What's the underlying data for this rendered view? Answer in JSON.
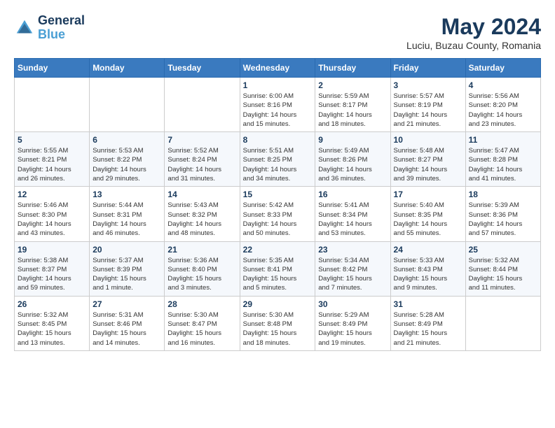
{
  "header": {
    "logo_line1": "General",
    "logo_line2": "Blue",
    "month_title": "May 2024",
    "location": "Luciu, Buzau County, Romania"
  },
  "weekdays": [
    "Sunday",
    "Monday",
    "Tuesday",
    "Wednesday",
    "Thursday",
    "Friday",
    "Saturday"
  ],
  "weeks": [
    [
      {
        "day": "",
        "info": ""
      },
      {
        "day": "",
        "info": ""
      },
      {
        "day": "",
        "info": ""
      },
      {
        "day": "1",
        "info": "Sunrise: 6:00 AM\nSunset: 8:16 PM\nDaylight: 14 hours\nand 15 minutes."
      },
      {
        "day": "2",
        "info": "Sunrise: 5:59 AM\nSunset: 8:17 PM\nDaylight: 14 hours\nand 18 minutes."
      },
      {
        "day": "3",
        "info": "Sunrise: 5:57 AM\nSunset: 8:19 PM\nDaylight: 14 hours\nand 21 minutes."
      },
      {
        "day": "4",
        "info": "Sunrise: 5:56 AM\nSunset: 8:20 PM\nDaylight: 14 hours\nand 23 minutes."
      }
    ],
    [
      {
        "day": "5",
        "info": "Sunrise: 5:55 AM\nSunset: 8:21 PM\nDaylight: 14 hours\nand 26 minutes."
      },
      {
        "day": "6",
        "info": "Sunrise: 5:53 AM\nSunset: 8:22 PM\nDaylight: 14 hours\nand 29 minutes."
      },
      {
        "day": "7",
        "info": "Sunrise: 5:52 AM\nSunset: 8:24 PM\nDaylight: 14 hours\nand 31 minutes."
      },
      {
        "day": "8",
        "info": "Sunrise: 5:51 AM\nSunset: 8:25 PM\nDaylight: 14 hours\nand 34 minutes."
      },
      {
        "day": "9",
        "info": "Sunrise: 5:49 AM\nSunset: 8:26 PM\nDaylight: 14 hours\nand 36 minutes."
      },
      {
        "day": "10",
        "info": "Sunrise: 5:48 AM\nSunset: 8:27 PM\nDaylight: 14 hours\nand 39 minutes."
      },
      {
        "day": "11",
        "info": "Sunrise: 5:47 AM\nSunset: 8:28 PM\nDaylight: 14 hours\nand 41 minutes."
      }
    ],
    [
      {
        "day": "12",
        "info": "Sunrise: 5:46 AM\nSunset: 8:30 PM\nDaylight: 14 hours\nand 43 minutes."
      },
      {
        "day": "13",
        "info": "Sunrise: 5:44 AM\nSunset: 8:31 PM\nDaylight: 14 hours\nand 46 minutes."
      },
      {
        "day": "14",
        "info": "Sunrise: 5:43 AM\nSunset: 8:32 PM\nDaylight: 14 hours\nand 48 minutes."
      },
      {
        "day": "15",
        "info": "Sunrise: 5:42 AM\nSunset: 8:33 PM\nDaylight: 14 hours\nand 50 minutes."
      },
      {
        "day": "16",
        "info": "Sunrise: 5:41 AM\nSunset: 8:34 PM\nDaylight: 14 hours\nand 53 minutes."
      },
      {
        "day": "17",
        "info": "Sunrise: 5:40 AM\nSunset: 8:35 PM\nDaylight: 14 hours\nand 55 minutes."
      },
      {
        "day": "18",
        "info": "Sunrise: 5:39 AM\nSunset: 8:36 PM\nDaylight: 14 hours\nand 57 minutes."
      }
    ],
    [
      {
        "day": "19",
        "info": "Sunrise: 5:38 AM\nSunset: 8:37 PM\nDaylight: 14 hours\nand 59 minutes."
      },
      {
        "day": "20",
        "info": "Sunrise: 5:37 AM\nSunset: 8:39 PM\nDaylight: 15 hours\nand 1 minute."
      },
      {
        "day": "21",
        "info": "Sunrise: 5:36 AM\nSunset: 8:40 PM\nDaylight: 15 hours\nand 3 minutes."
      },
      {
        "day": "22",
        "info": "Sunrise: 5:35 AM\nSunset: 8:41 PM\nDaylight: 15 hours\nand 5 minutes."
      },
      {
        "day": "23",
        "info": "Sunrise: 5:34 AM\nSunset: 8:42 PM\nDaylight: 15 hours\nand 7 minutes."
      },
      {
        "day": "24",
        "info": "Sunrise: 5:33 AM\nSunset: 8:43 PM\nDaylight: 15 hours\nand 9 minutes."
      },
      {
        "day": "25",
        "info": "Sunrise: 5:32 AM\nSunset: 8:44 PM\nDaylight: 15 hours\nand 11 minutes."
      }
    ],
    [
      {
        "day": "26",
        "info": "Sunrise: 5:32 AM\nSunset: 8:45 PM\nDaylight: 15 hours\nand 13 minutes."
      },
      {
        "day": "27",
        "info": "Sunrise: 5:31 AM\nSunset: 8:46 PM\nDaylight: 15 hours\nand 14 minutes."
      },
      {
        "day": "28",
        "info": "Sunrise: 5:30 AM\nSunset: 8:47 PM\nDaylight: 15 hours\nand 16 minutes."
      },
      {
        "day": "29",
        "info": "Sunrise: 5:30 AM\nSunset: 8:48 PM\nDaylight: 15 hours\nand 18 minutes."
      },
      {
        "day": "30",
        "info": "Sunrise: 5:29 AM\nSunset: 8:49 PM\nDaylight: 15 hours\nand 19 minutes."
      },
      {
        "day": "31",
        "info": "Sunrise: 5:28 AM\nSunset: 8:49 PM\nDaylight: 15 hours\nand 21 minutes."
      },
      {
        "day": "",
        "info": ""
      }
    ]
  ]
}
